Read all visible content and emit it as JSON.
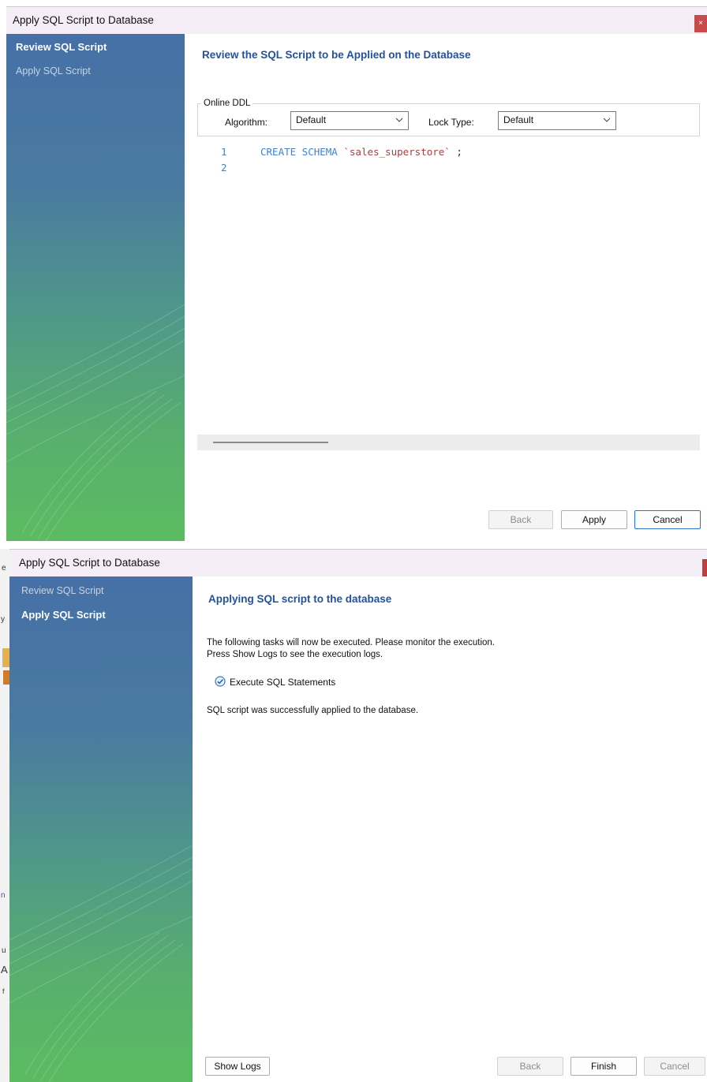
{
  "dialog_review": {
    "title": "Apply SQL Script to Database",
    "close_glyph": "×",
    "steps": [
      {
        "label": "Review SQL Script",
        "active": true
      },
      {
        "label": "Apply SQL Script",
        "active": false
      }
    ],
    "heading": "Review the SQL Script to be Applied on the Database",
    "online_ddl": {
      "legend": "Online DDL",
      "algorithm_label": "Algorithm:",
      "algorithm_value": "Default",
      "lock_type_label": "Lock Type:",
      "lock_type_value": "Default"
    },
    "script": {
      "lines": [
        {
          "number": "1",
          "keyword": "CREATE SCHEMA",
          "identifier": "`sales_superstore`",
          "terminator": ";"
        },
        {
          "number": "2",
          "keyword": "",
          "identifier": "",
          "terminator": ""
        }
      ]
    },
    "buttons": {
      "back": "Back",
      "apply": "Apply",
      "cancel": "Cancel"
    }
  },
  "dialog_apply": {
    "title": "Apply SQL Script to Database",
    "steps": [
      {
        "label": "Review SQL Script",
        "active": false
      },
      {
        "label": "Apply SQL Script",
        "active": true
      }
    ],
    "heading": "Applying SQL script to the database",
    "description_line1": "The following tasks will now be executed. Please monitor the execution.",
    "description_line2": "Press Show Logs to see the execution logs.",
    "task": {
      "label": "Execute SQL Statements",
      "icon": "check-circle-icon",
      "status": "done"
    },
    "result": "SQL script was successfully applied to the database.",
    "buttons": {
      "show_logs": "Show Logs",
      "back": "Back",
      "finish": "Finish",
      "cancel": "Cancel"
    }
  },
  "background_fragments": [
    "e",
    "y",
    "n",
    "u",
    "A",
    "f"
  ],
  "colors": {
    "heading": "#23529a",
    "sidebar_top": "#4670a6",
    "sidebar_bottom": "#5cbb62",
    "sql_keyword": "#3e84cc",
    "sql_identifier": "#a54040",
    "line_number": "#4a7fb8",
    "close_button": "#c94a4a"
  }
}
